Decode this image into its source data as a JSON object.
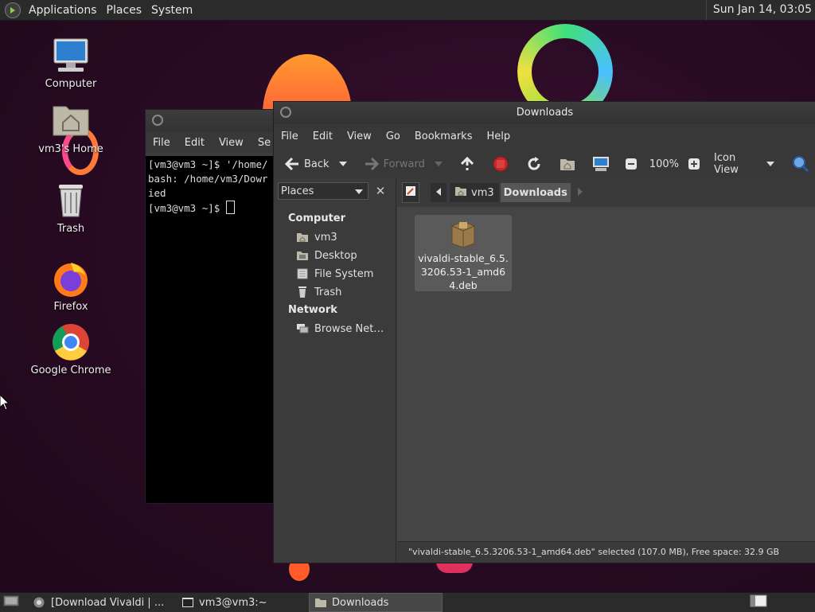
{
  "top_panel": {
    "menus": [
      "Applications",
      "Places",
      "System"
    ],
    "clock": "Sun Jan 14, 03:05"
  },
  "desktop_icons": [
    {
      "label": "Computer"
    },
    {
      "label": "vm3's Home"
    },
    {
      "label": "Trash"
    },
    {
      "label": "Firefox"
    },
    {
      "label": "Google Chrome"
    }
  ],
  "terminal": {
    "menus": [
      "File",
      "Edit",
      "View",
      "Se"
    ],
    "lines": [
      "[vm3@vm3 ~]$ '/home/",
      "bash: /home/vm3/Dowr",
      "ied",
      "[vm3@vm3 ~]$ "
    ]
  },
  "filemanager": {
    "title": "Downloads",
    "menus": [
      "File",
      "Edit",
      "View",
      "Go",
      "Bookmarks",
      "Help"
    ],
    "toolbar": {
      "back": "Back",
      "forward": "Forward",
      "zoom": "100%",
      "view_mode": "Icon View"
    },
    "sidebar": {
      "combo": "Places",
      "computer_heading": "Computer",
      "computer_items": [
        "vm3",
        "Desktop",
        "File System",
        "Trash"
      ],
      "network_heading": "Network",
      "network_items": [
        "Browse Net…"
      ]
    },
    "pathbar": [
      "vm3",
      "Downloads"
    ],
    "file": {
      "name": "vivaldi-stable_6.5.3206.53-1_amd64.deb"
    },
    "status": "\"vivaldi-stable_6.5.3206.53-1_amd64.deb\" selected (107.0 MB), Free space: 32.9 GB"
  },
  "taskbar": {
    "tasks": [
      "[Download Vivaldi | ...",
      "vm3@vm3:~",
      "Downloads"
    ]
  }
}
